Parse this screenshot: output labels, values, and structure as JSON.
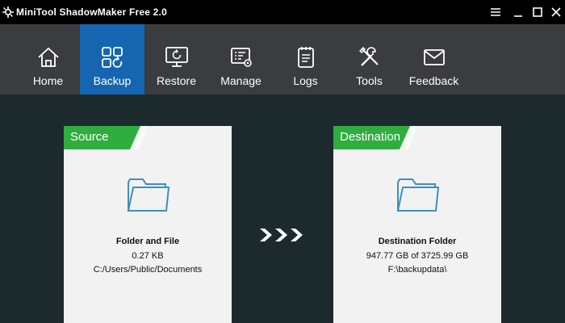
{
  "window": {
    "title": "MiniTool ShadowMaker Free 2.0",
    "controls": [
      "menu-icon",
      "minimize-icon",
      "maximize-icon",
      "close-icon"
    ]
  },
  "nav": {
    "items": [
      {
        "label": "Home",
        "icon": "home-icon",
        "active": false
      },
      {
        "label": "Backup",
        "icon": "backup-icon",
        "active": true
      },
      {
        "label": "Restore",
        "icon": "restore-icon",
        "active": false
      },
      {
        "label": "Manage",
        "icon": "manage-icon",
        "active": false
      },
      {
        "label": "Logs",
        "icon": "logs-icon",
        "active": false
      },
      {
        "label": "Tools",
        "icon": "tools-icon",
        "active": false
      },
      {
        "label": "Feedback",
        "icon": "feedback-icon",
        "active": false
      }
    ]
  },
  "source": {
    "tab_label": "Source",
    "title": "Folder and File",
    "size": "0.27 KB",
    "path": "C:/Users/Public/Documents"
  },
  "destination": {
    "tab_label": "Destination",
    "title": "Destination Folder",
    "size": "947.77 GB of 3725.99 GB",
    "path": "F:\\backupdata\\"
  },
  "colors": {
    "titlebar": "#000000",
    "navbar": "#3a3c3f",
    "nav_active": "#1565b0",
    "content_bg": "#1c2a2d",
    "tab_green": "#2fae3f",
    "folder_blue": "#3d8fbf"
  }
}
